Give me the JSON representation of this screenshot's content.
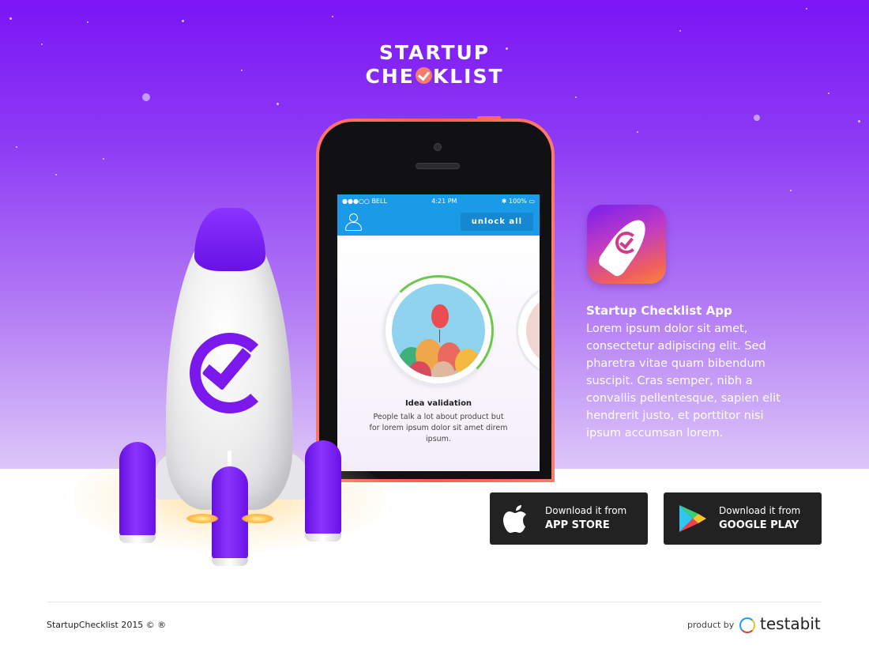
{
  "logo": {
    "line1": "STARTUP",
    "line2_prefix": "CHE",
    "line2_suffix": "KLIST"
  },
  "phone": {
    "status": {
      "carrier": "●●●○○ BELL",
      "time": "4:21 PM",
      "battery": "100%"
    },
    "unlock_label": "unlock all",
    "card": {
      "title": "Idea validation",
      "text": "People talk a lot about product but for lorem ipsum dolor sit amet direm ipsum."
    }
  },
  "app": {
    "title": "Startup Checklist App",
    "description": "Lorem ipsum dolor sit amet, consectetur adipiscing elit. Sed pharetra vitae quam bibendum suscipit. Cras semper, nibh a convallis pellentesque, sapien elit hendrerit justo, et porttitor nisi ipsum accumsan lorem."
  },
  "stores": {
    "apple": {
      "line1": "Download it from",
      "line2": "APP STORE"
    },
    "google": {
      "line1": "Download it from",
      "line2": "GOOGLE PLAY"
    }
  },
  "footer": {
    "copyright": "StartupChecklist 2015 © ®",
    "produced_by": "product by",
    "company": "testabit"
  },
  "colors": {
    "hero_top": "#7b15f5",
    "accent_purple": "#7a18ee",
    "phone_case": "#ff5a55",
    "app_blue": "#1a9be8",
    "store_button": "#222222"
  }
}
